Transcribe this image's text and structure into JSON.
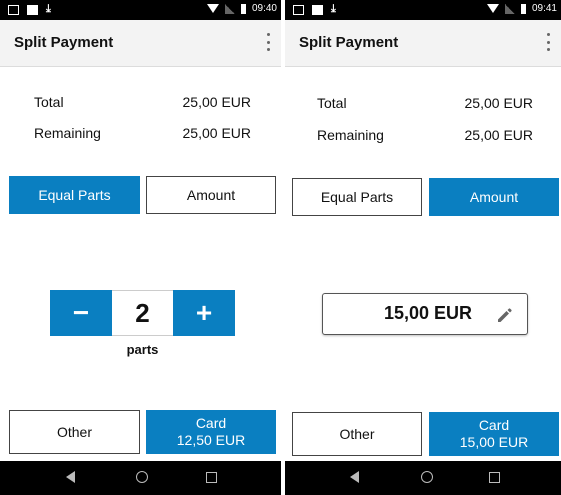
{
  "left": {
    "status_time": "09:40",
    "title": "Split Payment",
    "total_label": "Total",
    "total_value": "25,00 EUR",
    "remaining_label": "Remaining",
    "remaining_value": "25,00 EUR",
    "tab_equal": "Equal Parts",
    "tab_amount": "Amount",
    "active_tab": "Equal Parts",
    "stepper_minus": "−",
    "stepper_value": "2",
    "stepper_plus": "+",
    "parts_label": "parts",
    "other_label": "Other",
    "card_label": "Card",
    "card_amount": "12,50 EUR"
  },
  "right": {
    "status_time": "09:41",
    "title": "Split Payment",
    "total_label": "Total",
    "total_value": "25,00 EUR",
    "remaining_label": "Remaining",
    "remaining_value": "25,00 EUR",
    "tab_equal": "Equal Parts",
    "tab_amount": "Amount",
    "active_tab": "Amount",
    "amount_value": "15,00 EUR",
    "other_label": "Other",
    "card_label": "Card",
    "card_amount": "15,00 EUR"
  },
  "icons": [
    "overflow-menu-icon",
    "pencil-icon",
    "back-icon",
    "home-icon",
    "recents-icon",
    "wifi-icon",
    "signal-icon",
    "battery-icon",
    "download-icon"
  ],
  "colors": {
    "accent": "#0a7fc1",
    "status_bar": "#000000",
    "appbar": "#f3f3f3"
  }
}
